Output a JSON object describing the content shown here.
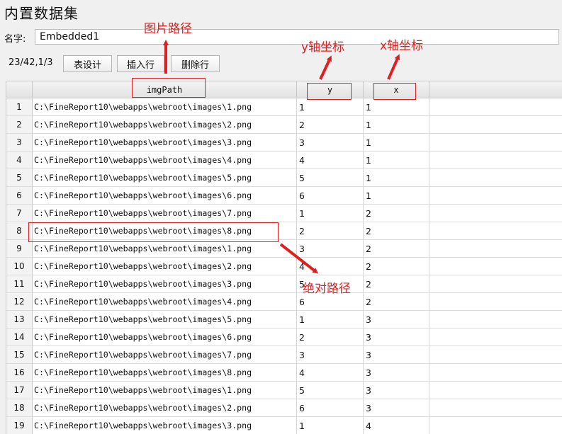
{
  "title": "内置数据集",
  "name": {
    "label": "名字:",
    "value": "Embedded1"
  },
  "toolbar": {
    "pager": "23/42,1/3",
    "buttons": [
      "表设计",
      "插入行",
      "删除行"
    ]
  },
  "table": {
    "columns": [
      "imgPath",
      "y",
      "x"
    ],
    "rows": [
      {
        "n": "1",
        "img": "C:\\FineReport10\\webapps\\webroot\\images\\1.png",
        "y": "1",
        "x": "1"
      },
      {
        "n": "2",
        "img": "C:\\FineReport10\\webapps\\webroot\\images\\2.png",
        "y": "2",
        "x": "1"
      },
      {
        "n": "3",
        "img": "C:\\FineReport10\\webapps\\webroot\\images\\3.png",
        "y": "3",
        "x": "1"
      },
      {
        "n": "4",
        "img": "C:\\FineReport10\\webapps\\webroot\\images\\4.png",
        "y": "4",
        "x": "1"
      },
      {
        "n": "5",
        "img": "C:\\FineReport10\\webapps\\webroot\\images\\5.png",
        "y": "5",
        "x": "1"
      },
      {
        "n": "6",
        "img": "C:\\FineReport10\\webapps\\webroot\\images\\6.png",
        "y": "6",
        "x": "1"
      },
      {
        "n": "7",
        "img": "C:\\FineReport10\\webapps\\webroot\\images\\7.png",
        "y": "1",
        "x": "2"
      },
      {
        "n": "8",
        "img": "C:\\FineReport10\\webapps\\webroot\\images\\8.png",
        "y": "2",
        "x": "2"
      },
      {
        "n": "9",
        "img": "C:\\FineReport10\\webapps\\webroot\\images\\1.png",
        "y": "3",
        "x": "2"
      },
      {
        "n": "10",
        "img": "C:\\FineReport10\\webapps\\webroot\\images\\2.png",
        "y": "4",
        "x": "2"
      },
      {
        "n": "11",
        "img": "C:\\FineReport10\\webapps\\webroot\\images\\3.png",
        "y": "5",
        "x": "2"
      },
      {
        "n": "12",
        "img": "C:\\FineReport10\\webapps\\webroot\\images\\4.png",
        "y": "6",
        "x": "2"
      },
      {
        "n": "13",
        "img": "C:\\FineReport10\\webapps\\webroot\\images\\5.png",
        "y": "1",
        "x": "3"
      },
      {
        "n": "14",
        "img": "C:\\FineReport10\\webapps\\webroot\\images\\6.png",
        "y": "2",
        "x": "3"
      },
      {
        "n": "15",
        "img": "C:\\FineReport10\\webapps\\webroot\\images\\7.png",
        "y": "3",
        "x": "3"
      },
      {
        "n": "16",
        "img": "C:\\FineReport10\\webapps\\webroot\\images\\8.png",
        "y": "4",
        "x": "3"
      },
      {
        "n": "17",
        "img": "C:\\FineReport10\\webapps\\webroot\\images\\1.png",
        "y": "5",
        "x": "3"
      },
      {
        "n": "18",
        "img": "C:\\FineReport10\\webapps\\webroot\\images\\2.png",
        "y": "6",
        "x": "3"
      },
      {
        "n": "19",
        "img": "C:\\FineReport10\\webapps\\webroot\\images\\3.png",
        "y": "1",
        "x": "4"
      }
    ]
  },
  "annotations": {
    "img_path": "图片路径",
    "y_axis": "y轴坐标",
    "x_axis": "x轴坐标",
    "absolute_path": "绝对路径",
    "color": "#e02020"
  }
}
